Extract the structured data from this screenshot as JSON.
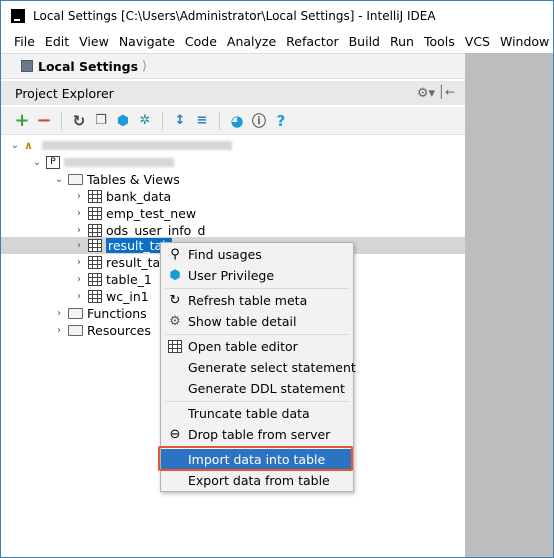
{
  "window": {
    "title": "Local Settings [C:\\Users\\Administrator\\Local Settings] - IntelliJ IDEA"
  },
  "menubar": [
    "File",
    "Edit",
    "View",
    "Navigate",
    "Code",
    "Analyze",
    "Refactor",
    "Build",
    "Run",
    "Tools",
    "VCS",
    "Window"
  ],
  "navbar": {
    "breadcrumb": "Local Settings"
  },
  "panel": {
    "title": "Project Explorer"
  },
  "toolbar": {
    "icons": [
      "add-icon",
      "remove-icon",
      "refresh-icon",
      "copy-icon",
      "privilege-icon",
      "bug-icon",
      "expand-all-icon",
      "collapse-all-icon",
      "stats-icon",
      "info-icon",
      "help-icon"
    ],
    "colors": {
      "add": "#3aa335",
      "remove": "#d64040",
      "accent": "#1e9bd7"
    }
  },
  "tree": {
    "folder_tables": "Tables & Views",
    "tables": [
      "bank_data",
      "emp_test_new",
      "ods_user_info_d",
      "result_tab",
      "result_tab",
      "table_1",
      "wc_in1"
    ],
    "folder_functions": "Functions",
    "folder_resources": "Resources"
  },
  "context_menu": {
    "items": [
      {
        "label": "Find usages",
        "icon": "search-icon"
      },
      {
        "label": "User Privilege",
        "icon": "privilege-icon"
      },
      {
        "label": "Refresh table meta",
        "icon": "refresh-icon"
      },
      {
        "label": "Show table detail",
        "icon": "detail-icon"
      },
      {
        "label": "Open table editor",
        "icon": "table-icon"
      },
      {
        "label": "Generate select statement",
        "icon": ""
      },
      {
        "label": "Generate DDL statement",
        "icon": ""
      },
      {
        "label": "Truncate table data",
        "icon": ""
      },
      {
        "label": "Drop table from server",
        "icon": "minus-circle-icon"
      },
      {
        "label": "Import data into table",
        "icon": "",
        "highlighted": true
      },
      {
        "label": "Export data from table",
        "icon": ""
      }
    ],
    "highlight_color": "#e8582c"
  }
}
